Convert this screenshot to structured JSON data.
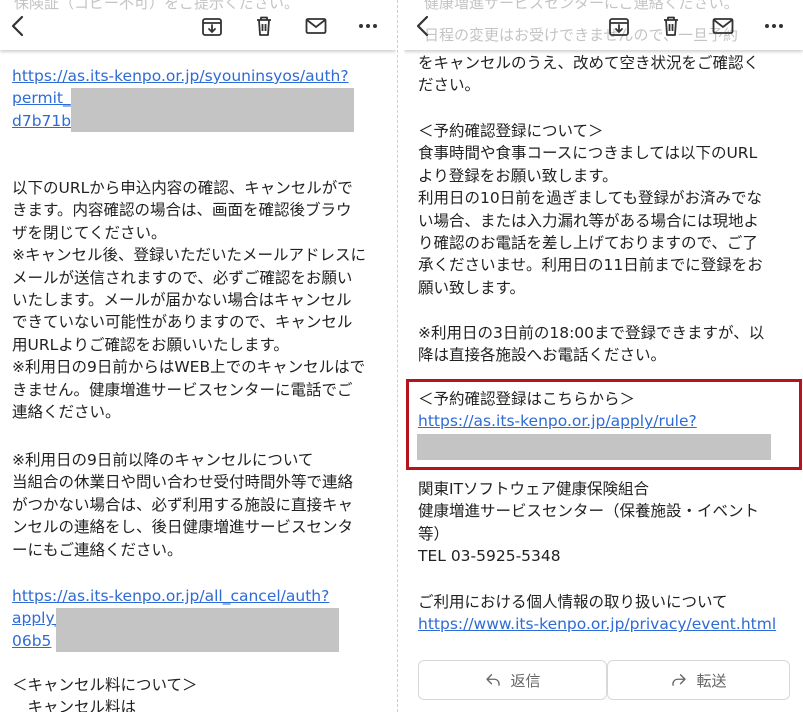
{
  "left": {
    "header_ghost": "保険証（コピー不可）をご提示ください。",
    "url1": [
      "https://as.its-kenpo.or.jp/syouninsyos/auth?",
      "permit_",
      "d7b71b"
    ],
    "body1": [
      "以下のURLから申込内容の確認、キャンセルがで",
      "きます。内容確認の場合は、画面を確認後ブラウ",
      "ザを閉じてください。",
      "※キャンセル後、登録いただいたメールアドレスに",
      "メールが送信されますので、必ずご確認をお願い",
      "いたします。メールが届かない場合はキャンセル",
      "できていない可能性がありますので、キャンセル",
      "用URLよりご確認をお願いいたします。",
      "※利用日の9日前からはWEB上でのキャンセルはで",
      "きません。健康増進サービスセンターに電話でご",
      "連絡ください。"
    ],
    "body2": [
      "※利用日の9日前以降のキャンセルについて",
      "当組合の休業日や問い合わせ受付時間外等で連絡",
      "がつかない場合は、必ず利用する施設に直接キャ",
      "ンセルの連絡をし、後日健康増進サービスセンタ",
      "ーにもご連絡ください。"
    ],
    "url2": [
      "https://as.its-kenpo.or.jp/all_cancel/auth?",
      "apply_",
      "06b5"
    ],
    "fee": [
      "＜キャンセル料について＞",
      "　キャンセル料は"
    ]
  },
  "right": {
    "header_ghost": [
      "健康増進サービスセンターにご連絡ください。",
      "日程の変更はお受けできませんので、一旦予約"
    ],
    "top_lines": [
      "をキャンセルのうえ、改めて空き状況をご確認く",
      "ださい。"
    ],
    "reserve_lines": [
      "＜予約確認登録について＞",
      "食事時間や食事コースにつきましては以下のURL",
      "より登録をお願い致します。",
      "利用日の10日前を過ぎましても登録がお済みでな",
      "い場合、または入力漏れ等がある場合には現地よ",
      "り確認のお電話を差し上げておりますので、ご了",
      "承くださいませ。利用日の11日前までに登録をお",
      "願い致します。"
    ],
    "deadline_lines": [
      "※利用日の3日前の18:00まで登録できますが、以",
      "降は直接各施設へお電話ください。"
    ],
    "register_title": "＜予約確認登録はこちらから＞",
    "register_url": "https://as.its-kenpo.or.jp/apply/rule?",
    "org_lines": [
      "関東ITソフトウェア健康保険組合",
      "健康増進サービスセンター（保養施設・イベント",
      "等）",
      "TEL 03-5925-5348"
    ],
    "privacy_title": "ご利用における個人情報の取り扱いについて",
    "privacy_url": "https://www.its-kenpo.or.jp/privacy/event.html",
    "reply_label": "返信",
    "forward_label": "転送"
  },
  "icons": [
    "back-icon",
    "archive-icon",
    "trash-icon",
    "mail-icon",
    "more-icon",
    "reply-icon",
    "forward-icon"
  ],
  "colors": {
    "link": "#2e6bd6",
    "highlight_border": "#b3141e",
    "redaction": "#c4c4c4"
  }
}
